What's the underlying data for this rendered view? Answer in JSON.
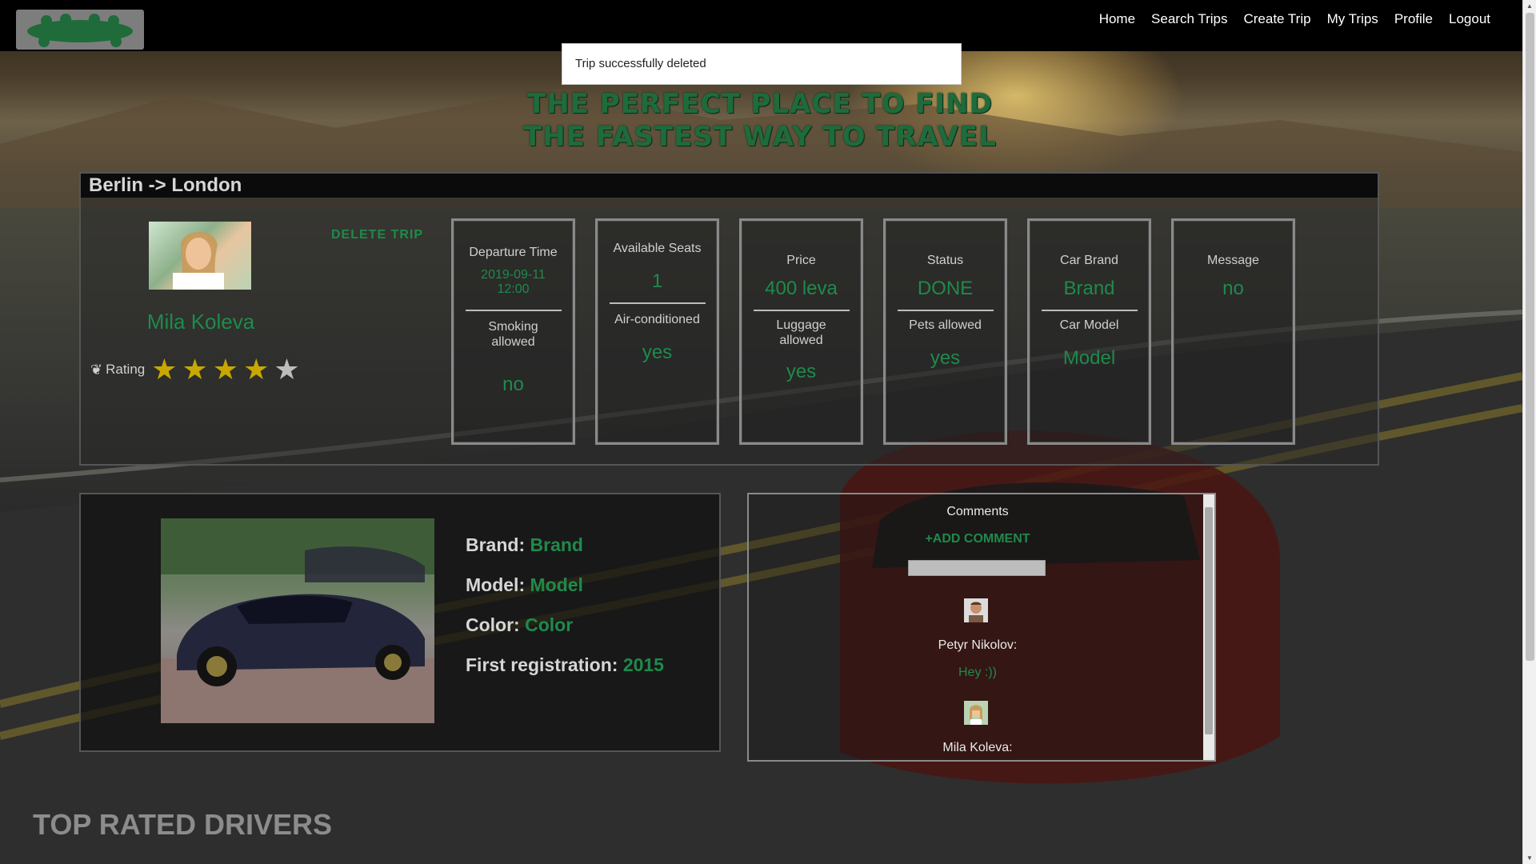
{
  "nav": {
    "links": [
      "Home",
      "Search Trips",
      "Create Trip",
      "My Trips",
      "Profile",
      "Logout"
    ]
  },
  "toast": {
    "message": "Trip successfully deleted"
  },
  "hero": {
    "line1": "THE PERFECT PLACE TO FIND",
    "line2": "THE FASTEST WAY TO TRAVEL"
  },
  "trip": {
    "route": "Berlin -> London",
    "delete_label": "DELETE TRIP",
    "driver": {
      "name": "Mila Koleva",
      "rating_label": "Rating",
      "rating": 4,
      "rating_max": 5
    },
    "cards": [
      {
        "top_label": "Departure Time",
        "top_value": "2019-09-11\n12:00",
        "bottom_label": "Smoking\nallowed",
        "bottom_value": "no"
      },
      {
        "top_label": "Available Seats",
        "top_value": "1",
        "bottom_label": "Air-conditioned",
        "bottom_value": "yes"
      },
      {
        "top_label": "Price",
        "top_value": "400 leva",
        "bottom_label": "Luggage\nallowed",
        "bottom_value": "yes"
      },
      {
        "top_label": "Status",
        "top_value": "DONE",
        "bottom_label": "Pets allowed",
        "bottom_value": "yes"
      },
      {
        "top_label": "Car Brand",
        "top_value": "Brand",
        "bottom_label": "Car Model",
        "bottom_value": "Model"
      },
      {
        "top_label": "Message",
        "top_value": "no",
        "bottom_label": "",
        "bottom_value": ""
      }
    ]
  },
  "car": {
    "brand_label": "Brand:",
    "brand": "Brand",
    "model_label": "Model:",
    "model": "Model",
    "color_label": "Color:",
    "color": "Color",
    "reg_label": "First registration:",
    "reg": "2015"
  },
  "comments": {
    "title": "Comments",
    "add_label": "+ADD COMMENT",
    "items": [
      {
        "author": "Petyr Nikolov:",
        "text": "Hey :))"
      },
      {
        "author": "Mila Koleva:",
        "text": ""
      }
    ]
  },
  "section": {
    "top_rated": "TOP RATED DRIVERS"
  },
  "colors": {
    "accent": "#1f8a4b",
    "star": "#c8a800",
    "nav_bg": "#000000"
  }
}
